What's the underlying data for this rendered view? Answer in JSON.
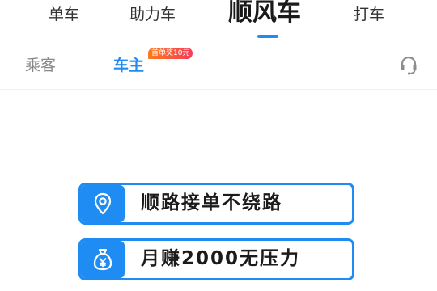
{
  "top_tabs": {
    "bike": "单车",
    "ebike": "助力车",
    "carpool": "顺风车",
    "taxi": "打车"
  },
  "sub_tabs": {
    "passenger": "乘客",
    "driver": "车主",
    "promo_badge": "首单奖10元"
  },
  "icons": {
    "service": "headset-icon",
    "banner1": "location-pin-icon",
    "banner2": "money-bag-icon"
  },
  "banners": [
    {
      "text": "顺路接单不绕路"
    },
    {
      "text": "月赚2000无压力"
    }
  ],
  "colors": {
    "accent": "#1f8cf3",
    "badge_start": "#ff7a1a",
    "badge_end": "#f73c5a"
  }
}
